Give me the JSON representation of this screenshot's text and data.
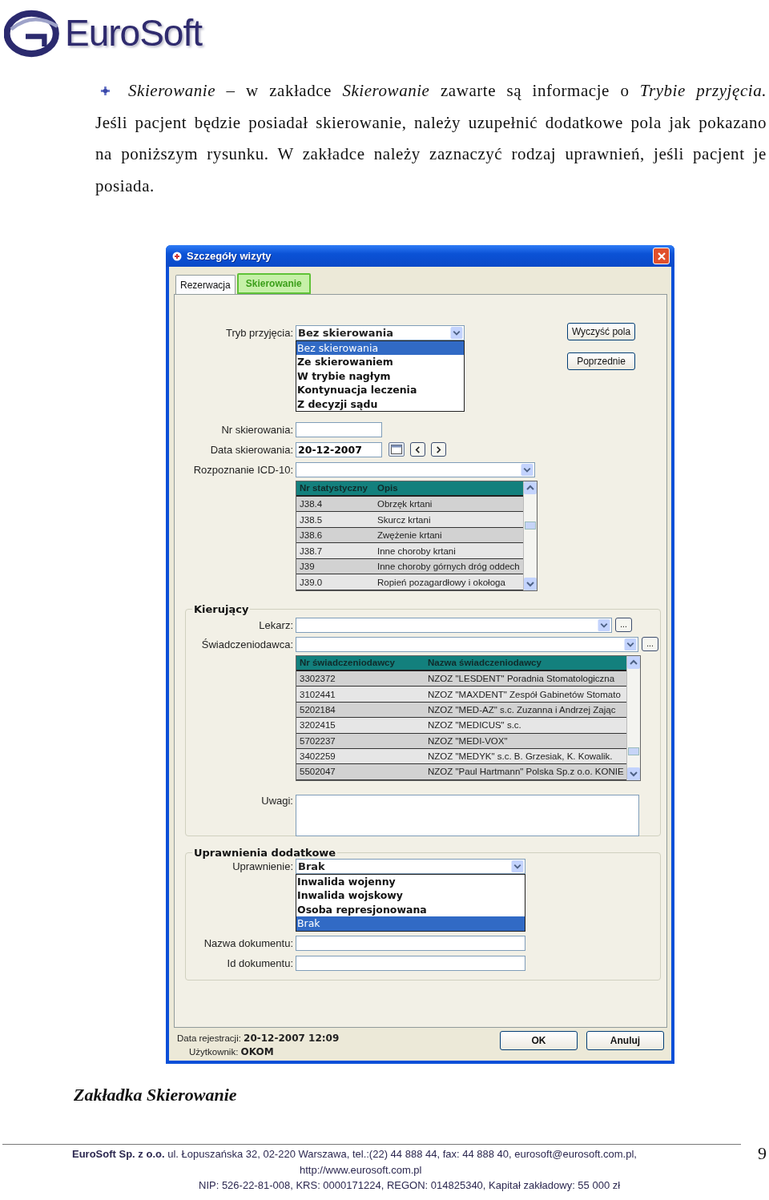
{
  "logo": {
    "text": "EuroSoft"
  },
  "intro": {
    "first_line": "*Skierowanie* – w zakładce *Skierowanie* zawarte są informacje o *Trybie przyjęcia.*",
    "rest": "Jeśli pacjent będzie posiadał skierowanie, należy uzupełnić dodatkowe pola jak pokazano na poniższym rysunku. W zakładce należy zaznaczyć rodzaj uprawnień, jeśli pacjent je posiada."
  },
  "dialog": {
    "title": "Szczegóły wizyty",
    "tabs": [
      {
        "label": "Rezerwacja",
        "selected": false
      },
      {
        "label": "Skierowanie",
        "selected": true
      }
    ],
    "side_buttons": [
      "Wyczyść pola",
      "Poprzednie"
    ],
    "tryb": {
      "label": "Tryb przyjęcia:",
      "value": "Bez skierowania",
      "options": [
        {
          "label": "Bez skierowania",
          "selected": true
        },
        {
          "label": "Ze skierowaniem",
          "selected": false
        },
        {
          "label": "W trybie nagłym",
          "selected": false
        },
        {
          "label": "Kontynuacja leczenia",
          "selected": false
        },
        {
          "label": "Z decyzji sądu",
          "selected": false
        }
      ]
    },
    "nr_label": "Nr skierowania:",
    "data": {
      "label": "Data skierowania:",
      "value": "20-12-2007"
    },
    "icd": {
      "label": "Rozpoznanie ICD-10:",
      "columns": [
        "Nr statystyczny",
        "Opis"
      ],
      "rows": [
        [
          "J38.4",
          "Obrzęk krtani"
        ],
        [
          "J38.5",
          "Skurcz krtani"
        ],
        [
          "J38.6",
          "Zwężenie krtani"
        ],
        [
          "J38.7",
          "Inne choroby krtani"
        ],
        [
          "J39",
          "Inne choroby górnych dróg oddech"
        ],
        [
          "J39.0",
          "Ropień pozagardłowy i okołoga"
        ]
      ]
    },
    "kierujacy": {
      "title": "Kierujący",
      "lekarz_label": "Lekarz:",
      "swiad_label": "Świadczeniodawca:",
      "browse_label": "...",
      "columns": [
        "Nr świadczeniodawcy",
        "Nazwa świadczeniodawcy"
      ],
      "rows": [
        [
          "3302372",
          "NZOZ \"LESDENT\" Poradnia Stomatologiczna"
        ],
        [
          "3102441",
          "NZOZ \"MAXDENT\" Zespół Gabinetów Stomato"
        ],
        [
          "5202184",
          "NZOZ \"MED-AZ\" s.c. Zuzanna i Andrzej Zając"
        ],
        [
          "3202415",
          "NZOZ \"MEDICUS\" s.c."
        ],
        [
          "5702237",
          "NZOZ \"MEDI-VOX\""
        ],
        [
          "3402259",
          "NZOZ \"MEDYK\" s.c. B. Grzesiak, K. Kowalik."
        ],
        [
          "5502047",
          "NZOZ \"Paul Hartmann\" Polska Sp.z o.o. KONIE"
        ]
      ],
      "uwagi_label": "Uwagi:"
    },
    "uprawnienia": {
      "title": "Uprawnienia dodatkowe",
      "label": "Uprawnienie:",
      "value": "Brak",
      "options": [
        {
          "label": "Inwalida wojenny",
          "selected": false
        },
        {
          "label": "Inwalida wojskowy",
          "selected": false
        },
        {
          "label": "Osoba represjonowana",
          "selected": false
        },
        {
          "label": "Brak",
          "selected": true
        }
      ],
      "nazwa_label": "Nazwa dokumentu:",
      "id_label": "Id dokumentu:"
    },
    "registration": {
      "label": "Data rejestracji:",
      "value": "20-12-2007 12:09"
    },
    "user": {
      "label": "Użytkownik:",
      "value": "OKOM"
    },
    "buttons": [
      "OK",
      "Anuluj"
    ]
  },
  "caption": "Zakładka Skierowanie",
  "footer": {
    "line1": "**EuroSoft Sp. z o.o.** ul. Łopuszańska 32, 02-220 Warszawa, tel.:(22) 44 888 44, fax: 44 888 40, eurosoft@eurosoft.com.pl,",
    "line2": "http://www.eurosoft.com.pl",
    "line3": "NIP: 526-22-81-008, KRS: 0000171224, REGON: 014825340, Kapitał zakładowy: 55 000 zł",
    "page_number": "9"
  }
}
